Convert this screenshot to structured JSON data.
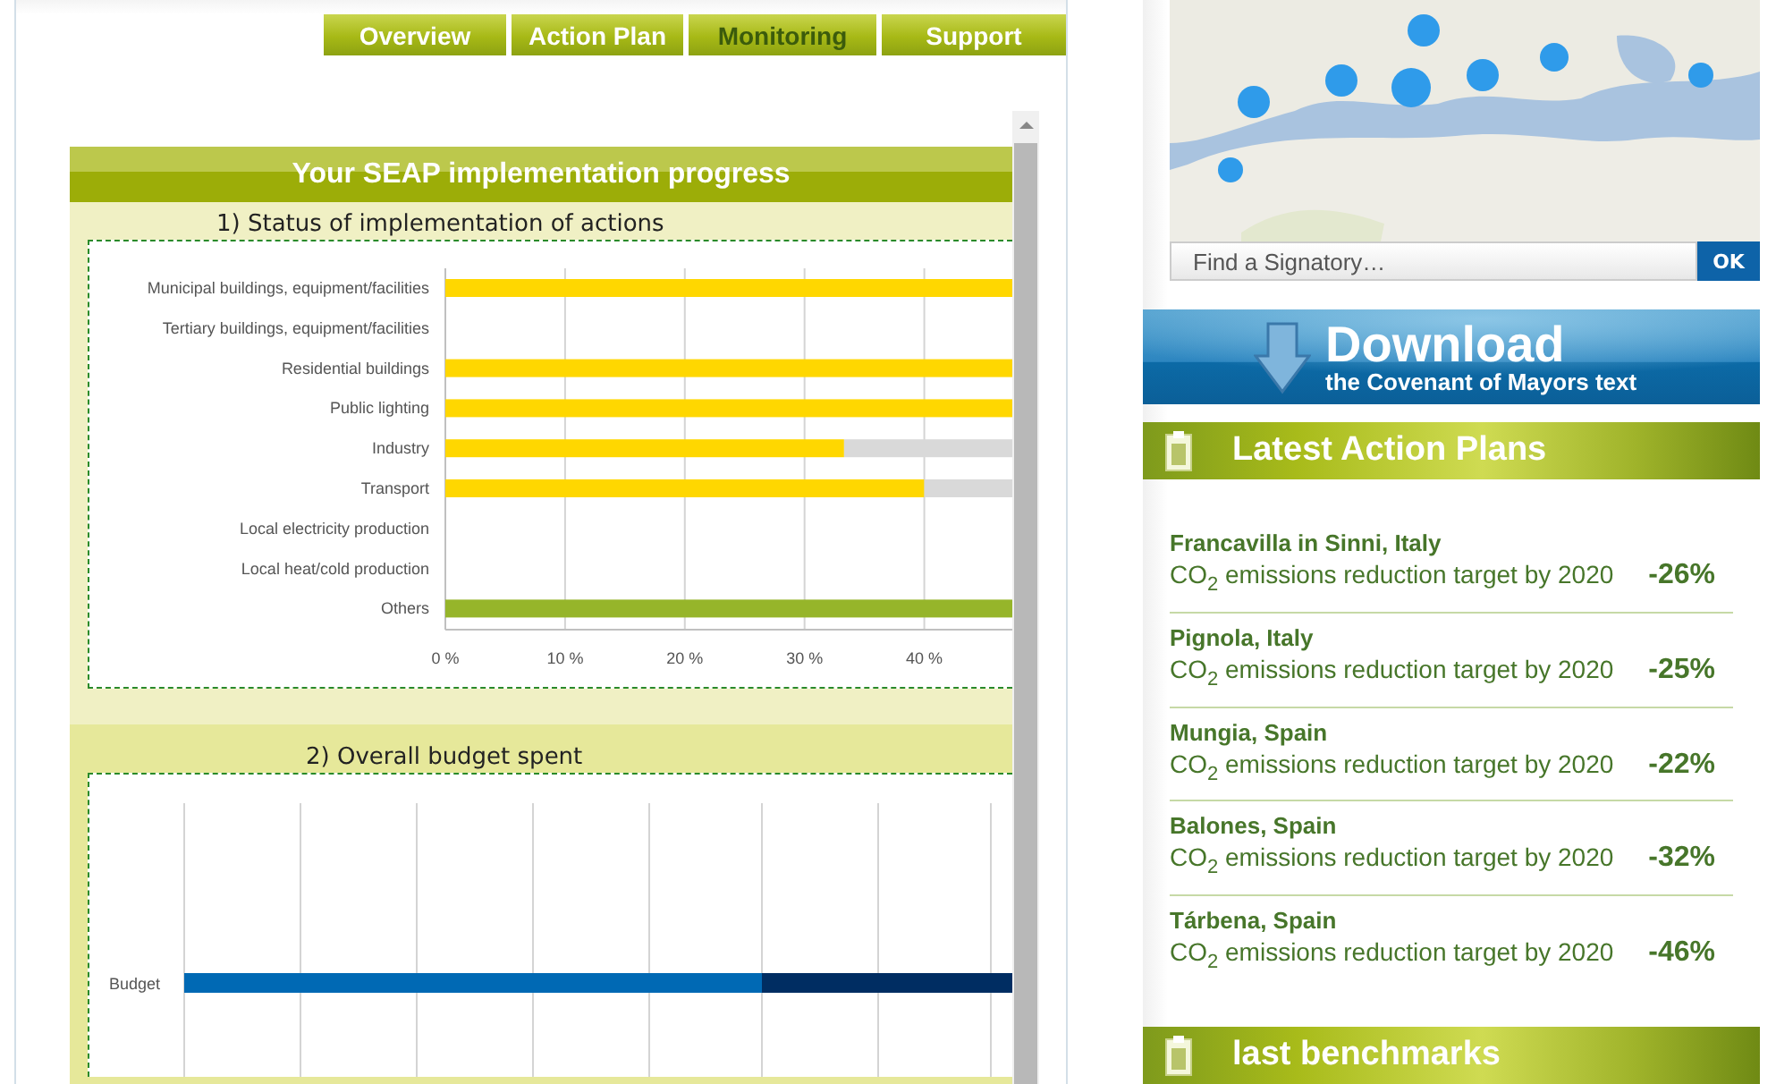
{
  "tabs": [
    {
      "label": "Overview",
      "selected": false
    },
    {
      "label": "Action Plan",
      "selected": false
    },
    {
      "label": "Monitoring",
      "selected": true
    },
    {
      "label": "Support",
      "selected": false
    }
  ],
  "progress": {
    "title": "Your SEAP implementation progress",
    "status": {
      "title": "1) Status of implementation of actions",
      "chart_data": {
        "type": "bar",
        "orientation": "horizontal",
        "stacked": true,
        "categories": [
          "Municipal buildings, equipment/facilities",
          "Tertiary buildings, equipment/facilities",
          "Residential buildings",
          "Public lighting",
          "Industry",
          "Transport",
          "Local electricity production",
          "Local heat/cold production",
          "Others"
        ],
        "series": [
          {
            "color": "#ffd700",
            "values": [
              47.5,
              null,
              47.5,
              47.5,
              33.3,
              40,
              null,
              null,
              null
            ]
          },
          {
            "color": "#d9d9d9",
            "values": [
              null,
              null,
              null,
              null,
              14.2,
              7.5,
              null,
              null,
              null
            ]
          },
          {
            "color": "#96b52a",
            "values": [
              null,
              null,
              null,
              null,
              null,
              null,
              null,
              null,
              47.5
            ]
          }
        ],
        "xlim": [
          0,
          47.5
        ],
        "grid": true,
        "xticks": [
          {
            "value": 0,
            "label": "0 %"
          },
          {
            "value": 10,
            "label": "10 %"
          },
          {
            "value": 20,
            "label": "20 %"
          },
          {
            "value": 30,
            "label": "30 %"
          },
          {
            "value": 40,
            "label": "40 %"
          }
        ]
      }
    },
    "budget": {
      "title": "2) Overall budget spent",
      "bar_label": "Budget"
    }
  },
  "map": {
    "search": {
      "placeholder": "Find a Signatory…"
    },
    "button": "OK"
  },
  "download": {
    "title": "Download",
    "subtitle": "the Covenant of Mayors text"
  },
  "latest": {
    "title": "Latest Action Plans",
    "items": [
      {
        "name": "Francavilla in Sinni, Italy",
        "target": "CO$_{2}$ emissions reduction target by 2020",
        "value": "-26%"
      },
      {
        "name": "Pignola, Italy",
        "target": "CO$_{2}$ emissions reduction target by 2020",
        "value": "-25%"
      },
      {
        "name": "Mungia, Spain",
        "target": "CO$_{2}$ emissions reduction target by 2020",
        "value": "-22%"
      },
      {
        "name": "Balones, Spain",
        "target": "CO$_{2}$ emissions reduction target by 2020",
        "value": "-32%"
      },
      {
        "name": "Tárbena, Spain",
        "target": "CO$_{2}$ emissions reduction target by 2020",
        "value": "-46%"
      }
    ]
  },
  "benchmarks": {
    "title": "last benchmarks"
  }
}
